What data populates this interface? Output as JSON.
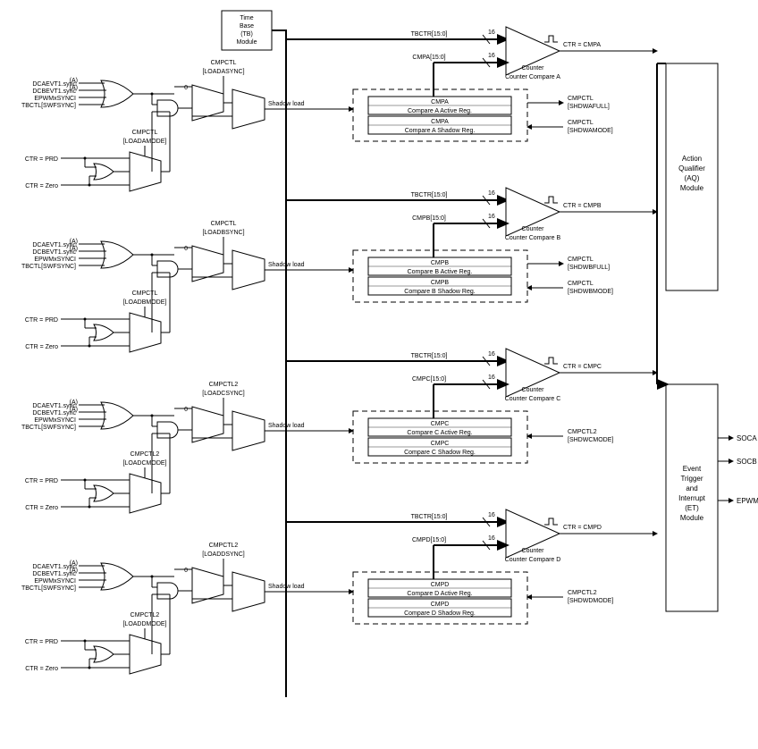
{
  "tb_module": {
    "line1": "Time",
    "line2": "Base",
    "line3": "(TB)",
    "line4": "Module"
  },
  "aq_module": {
    "line1": "Action",
    "line2": "Qualifier",
    "line3": "(AQ)",
    "line4": "Module"
  },
  "et_module": {
    "line1": "Event",
    "line2": "Trigger",
    "line3": "and",
    "line4": "Interrupt",
    "line5": "(ET)",
    "line6": "Module"
  },
  "et_outputs": {
    "soca": "SOCA",
    "socb": "SOCB",
    "epwmxint": "EPWMxINT"
  },
  "common_inputs": {
    "dcaevt1": "DCAEVT1.sync",
    "dcbevt1": "DCBEVT1.sync",
    "epwmxsynci": "EPWMxSYNCI",
    "tbctl_swfsync": "TBCTL[SWFSYNC]",
    "ctr_prd": "CTR = PRD",
    "ctr_zero": "CTR = Zero",
    "zero": "0",
    "shadow_load": "Shadow load",
    "superscript": "(A)",
    "sixteen": "16"
  },
  "sections": [
    {
      "sync_label_line1": "CMPCTL",
      "sync_label_line2": "[LOADASYNC]",
      "mode_label_line1": "CMPCTL",
      "mode_label_line2": "[LOADAMODE]",
      "tbctr": "TBCTR[15:0]",
      "cmp_signal": "CMPA[15:0]",
      "ctr_eq": "CTR = CMPA",
      "counter_text": "Counter Compare A",
      "active_top": "CMPA",
      "active_bottom": "Compare A Active Reg.",
      "shadow_top": "CMPA",
      "shadow_bottom": "Compare A Shadow Reg.",
      "ctrl1_line1": "CMPCTL",
      "ctrl1_line2": "[SHDWAFULL]",
      "ctrl2_line1": "CMPCTL",
      "ctrl2_line2": "[SHDWAMODE]"
    },
    {
      "sync_label_line1": "CMPCTL",
      "sync_label_line2": "[LOADBSYNC]",
      "mode_label_line1": "CMPCTL",
      "mode_label_line2": "[LOADBMODE]",
      "tbctr": "TBCTR[15:0]",
      "cmp_signal": "CMPB[15:0]",
      "ctr_eq": "CTR = CMPB",
      "counter_text": "Counter Compare B",
      "active_top": "CMPB",
      "active_bottom": "Compare B Active Reg.",
      "shadow_top": "CMPB",
      "shadow_bottom": "Compare B Shadow Reg.",
      "ctrl1_line1": "CMPCTL",
      "ctrl1_line2": "[SHDWBFULL]",
      "ctrl2_line1": "CMPCTL",
      "ctrl2_line2": "[SHDWBMODE]"
    },
    {
      "sync_label_line1": "CMPCTL2",
      "sync_label_line2": "[LOADCSYNC]",
      "mode_label_line1": "CMPCTL2",
      "mode_label_line2": "[LOADCMODE]",
      "tbctr": "TBCTR[15:0]",
      "cmp_signal": "CMPC[15:0]",
      "ctr_eq": "CTR = CMPC",
      "counter_text": "Counter Compare C",
      "active_top": "CMPC",
      "active_bottom": "Compare C Active Reg.",
      "shadow_top": "CMPC",
      "shadow_bottom": "Compare C Shadow Reg.",
      "ctrl1_line1": "CMPCTL2",
      "ctrl1_line2": "[SHDWCMODE]"
    },
    {
      "sync_label_line1": "CMPCTL2",
      "sync_label_line2": "[LOADDSYNC]",
      "mode_label_line1": "CMPCTL2",
      "mode_label_line2": "[LOADDMODE]",
      "tbctr": "TBCTR[15:0]",
      "cmp_signal": "CMPD[15:0]",
      "ctr_eq": "CTR = CMPD",
      "counter_text": "Counter Compare D",
      "active_top": "CMPD",
      "active_bottom": "Compare D Active Reg.",
      "shadow_top": "CMPD",
      "shadow_bottom": "Compare D Shadow Reg.",
      "ctrl1_line1": "CMPCTL2",
      "ctrl1_line2": "[SHDWDMODE]"
    }
  ]
}
